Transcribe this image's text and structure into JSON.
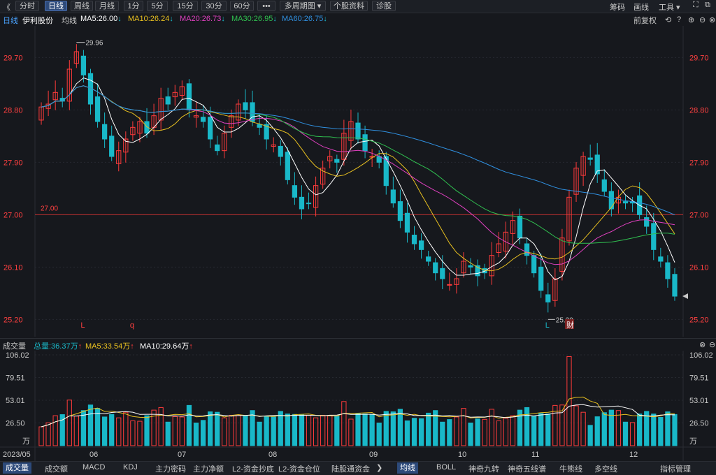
{
  "toolbar": {
    "back": "《",
    "tabs": [
      {
        "label": "分时",
        "active": false
      },
      {
        "label": "日线",
        "active": true
      },
      {
        "label": "周线",
        "active": false
      },
      {
        "label": "月线",
        "active": false
      },
      {
        "label": "1分",
        "active": false
      },
      {
        "label": "5分",
        "active": false
      },
      {
        "label": "15分",
        "active": false
      },
      {
        "label": "30分",
        "active": false
      },
      {
        "label": "60分",
        "active": false
      },
      {
        "label": "•••",
        "active": false
      }
    ],
    "multi_period": "多周期图",
    "stock_info": "个股资料",
    "diagnose": "诊股",
    "right": [
      "筹码",
      "画线",
      "工具"
    ]
  },
  "info": {
    "period": "日线",
    "stock_name": "伊利股份",
    "ma_label": "均线",
    "ma5": "MA5:26.00",
    "ma10": "MA10:26.24",
    "ma20": "MA20:26.73",
    "ma30": "MA30:26.95",
    "ma60": "MA60:26.75",
    "adjust": "前复权"
  },
  "price_axis": [
    "29.70",
    "28.80",
    "27.90",
    "27.00",
    "26.10",
    "25.20"
  ],
  "annotations": {
    "high": "29.96",
    "low": "25.20",
    "ref_line": "27.00",
    "marks": [
      "L",
      "q",
      "L",
      "财"
    ]
  },
  "volume": {
    "title": "成交量",
    "total": "总量:36.37万",
    "ma5": "MA5:33.54万",
    "ma10": "MA10:29.64万",
    "axis": [
      "106.02",
      "79.51",
      "53.01",
      "26.50",
      "万"
    ]
  },
  "date_axis": [
    "2023/05",
    "06",
    "07",
    "08",
    "09",
    "10",
    "11",
    "12"
  ],
  "bottom_tabs": [
    "成交量",
    "成交额",
    "MACD",
    "KDJ",
    "主力密码",
    "主力净额",
    "L2-资金抄底",
    "L2-资金仓位",
    "陆股通资金"
  ],
  "bottom_right_tabs": [
    "均线",
    "BOLL",
    "神奇九转",
    "神奇五线谱",
    "牛熊线",
    "多空线",
    "指标管理"
  ],
  "colors": {
    "up": "#ff3b3b",
    "down": "#19b8c8",
    "ma5": "#ffffff",
    "ma10": "#e8c020",
    "ma20": "#e040c0",
    "ma30": "#30c050",
    "ma60": "#3090e0",
    "ref": "#c03030"
  },
  "chart_data": {
    "type": "candlestick",
    "period": "daily",
    "high_mark": 29.96,
    "low_mark": 25.2,
    "ref_price": 27.0,
    "ylim": [
      25.0,
      30.1
    ],
    "volume_ylim": [
      0,
      106.02
    ],
    "volume_unit": "万",
    "current": {
      "ma5": 26.0,
      "ma10": 26.24,
      "ma20": 26.73,
      "ma30": 26.95,
      "ma60": 26.75,
      "volume": 36.37,
      "vol_ma5": 33.54,
      "vol_ma10": 29.64
    },
    "close_series": [
      28.85,
      28.9,
      29.1,
      28.95,
      29.5,
      29.8,
      29.4,
      28.9,
      28.6,
      28.3,
      28.0,
      28.1,
      28.3,
      28.5,
      28.6,
      28.4,
      28.7,
      29.0,
      28.9,
      29.1,
      29.2,
      28.8,
      28.7,
      28.6,
      28.3,
      28.1,
      28.4,
      28.7,
      28.9,
      28.8,
      28.6,
      28.5,
      28.3,
      28.2,
      28.0,
      27.6,
      27.3,
      27.1,
      27.2,
      27.5,
      27.8,
      28.0,
      27.9,
      28.4,
      28.6,
      28.3,
      28.1,
      28.0,
      27.9,
      27.5,
      27.2,
      26.9,
      26.7,
      26.5,
      26.4,
      26.2,
      26.0,
      25.9,
      25.8,
      25.9,
      26.2,
      26.1,
      25.95,
      26.0,
      26.3,
      26.5,
      26.7,
      26.9,
      26.6,
      26.3,
      26.0,
      25.7,
      25.5,
      25.9,
      26.6,
      27.3,
      27.8,
      28.0,
      27.95,
      27.7,
      27.4,
      27.1,
      27.3,
      27.2,
      27.2,
      27.0,
      26.8,
      26.4,
      26.2,
      25.9,
      25.6
    ]
  }
}
